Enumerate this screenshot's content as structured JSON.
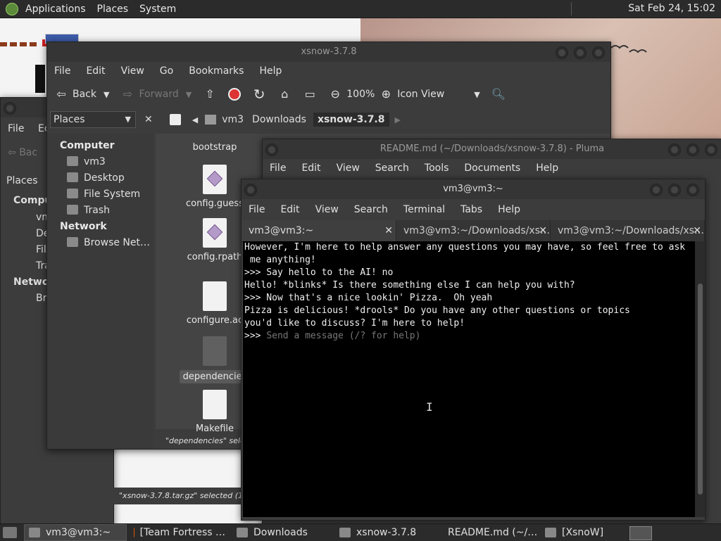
{
  "top_panel": {
    "menus": [
      "Applications",
      "Places",
      "System"
    ],
    "clock": "Sat Feb 24, 15:02"
  },
  "caja_back": {
    "menu": [
      "File",
      "Ec"
    ],
    "back_label": "Bac",
    "places_label": "Places",
    "items": [
      "Comput",
      "vm",
      "De",
      "Fil",
      "Tra",
      "Networ",
      "Bro"
    ],
    "status": "\"xsnow-3.7.8.tar.gz\" selected (1.4 M"
  },
  "caja": {
    "title": "xsnow-3.7.8",
    "menu": [
      "File",
      "Edit",
      "View",
      "Go",
      "Bookmarks",
      "Help"
    ],
    "toolbar": {
      "back": "Back",
      "forward": "Forward",
      "zoom": "100%",
      "view_mode": "Icon View"
    },
    "sidebar_selector": "Places",
    "breadcrumb": [
      "vm3",
      "Downloads",
      "xsnow-3.7.8"
    ],
    "sidebar": {
      "computer_header": "Computer",
      "computer_items": [
        "vm3",
        "Desktop",
        "File System",
        "Trash"
      ],
      "network_header": "Network",
      "network_items": [
        "Browse Net…"
      ]
    },
    "files": [
      "bootstrap",
      "config.guess",
      "config.rpath",
      "configure.ac",
      "dependencies",
      "Makefile"
    ],
    "status": "\"dependencies\" select"
  },
  "pluma": {
    "title": "README.md (~/Downloads/xsnow-3.7.8) - Pluma",
    "menu": [
      "File",
      "Edit",
      "View",
      "Search",
      "Tools",
      "Documents",
      "Help"
    ]
  },
  "terminal": {
    "title": "vm3@vm3:~",
    "menu": [
      "File",
      "Edit",
      "View",
      "Search",
      "Terminal",
      "Tabs",
      "Help"
    ],
    "tabs": [
      "vm3@vm3:~",
      "vm3@vm3:~/Downloads/xs…",
      "vm3@vm3:~/Downloads/xs…"
    ],
    "lines": [
      "However, I'm here to help answer any questions you may have, so feel free to ask",
      " me anything!",
      "",
      ">>> Say hello to the AI! no",
      "Hello! *blinks* Is there something else I can help you with?",
      "",
      "",
      ">>> Now that's a nice lookin' Pizza.  Oh yeah",
      "Pizza is delicious! *drools* Do you have any other questions or topics",
      "you'd like to discuss? I'm here to help!",
      ""
    ],
    "prompt": ">>> ",
    "input_placeholder": "Send a message (/? for help)"
  },
  "taskbar": {
    "tasks": [
      "vm3@vm3:~",
      "[Team Fortress …",
      "Downloads",
      "xsnow-3.7.8",
      "README.md (~/…",
      "[XsnoW]"
    ]
  }
}
